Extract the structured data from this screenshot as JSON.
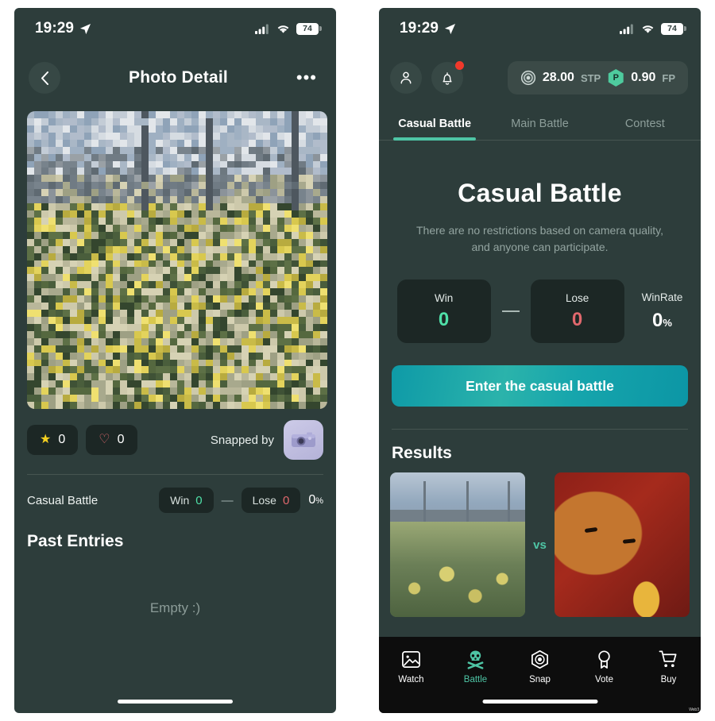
{
  "status_bar": {
    "time": "19:29",
    "battery_level": "74",
    "location_icon": "location-arrow-icon",
    "signal_icon": "cellular-signal-icon",
    "wifi_icon": "wifi-icon"
  },
  "left_phone": {
    "header": {
      "title": "Photo Detail",
      "back_icon": "chevron-left-icon",
      "menu_icon": "ellipsis-icon"
    },
    "photo": {
      "alt": "pixelated photo of goldenrod flowers with industrial skyline",
      "mosaic": true
    },
    "engagement": {
      "star_icon": "star-icon",
      "star_count": "0",
      "heart_icon": "heart-icon",
      "heart_count": "0",
      "snapped_by_label": "Snapped by",
      "avatar_icon": "camera-avatar-icon"
    },
    "battle_summary": {
      "name": "Casual Battle",
      "win_label": "Win",
      "win_value": "0",
      "dash": "—",
      "lose_label": "Lose",
      "lose_value": "0",
      "winrate": "0",
      "percent_symbol": "%"
    },
    "past_entries": {
      "heading": "Past Entries",
      "empty_text": "Empty :)"
    }
  },
  "right_phone": {
    "top_bar": {
      "profile_icon": "person-icon",
      "notification_icon": "bell-icon",
      "has_notification_dot": true,
      "currency": {
        "stp_icon": "stp-token-icon",
        "stp_amount": "28.00",
        "stp_unit": "STP",
        "fp_icon": "P",
        "fp_amount": "0.90",
        "fp_unit": "FP"
      }
    },
    "tabs": [
      {
        "label": "Casual Battle",
        "active": true
      },
      {
        "label": "Main Battle",
        "active": false
      },
      {
        "label": "Contest",
        "active": false
      }
    ],
    "hero": {
      "title": "Casual Battle",
      "subtitle": "There are no restrictions based on camera quality, and anyone can participate."
    },
    "scores": {
      "win_label": "Win",
      "win_value": "0",
      "lose_label": "Lose",
      "lose_value": "0",
      "winrate_label": "WinRate",
      "winrate_value": "0",
      "percent_symbol": "%"
    },
    "cta": {
      "label": "Enter the casual battle"
    },
    "results": {
      "heading": "Results",
      "vs_label": "vs",
      "left_photo_alt": "goldenrod field with industrial skyline",
      "right_photo_alt": "sleeping shiba inu dog on red blanket"
    },
    "bottom_nav": [
      {
        "label": "Watch",
        "icon": "image-icon",
        "active": false
      },
      {
        "label": "Battle",
        "icon": "skull-crossbones-icon",
        "active": true
      },
      {
        "label": "Snap",
        "icon": "camera-lens-hexagon-icon",
        "active": false
      },
      {
        "label": "Vote",
        "icon": "award-ribbon-icon",
        "active": false
      },
      {
        "label": "Buy",
        "icon": "shopping-cart-icon",
        "active": false
      }
    ]
  },
  "watermark": {
    "text": "Web3",
    "sub": "NEWS"
  },
  "colors": {
    "phone_background": "#2d3d3b",
    "card_background": "#1c2725",
    "accent_teal": "#4ec5a5",
    "win_green": "#4fe0a8",
    "lose_red": "#e0686d",
    "star_yellow": "#f5d020",
    "nav_background": "#0d0d0d"
  }
}
